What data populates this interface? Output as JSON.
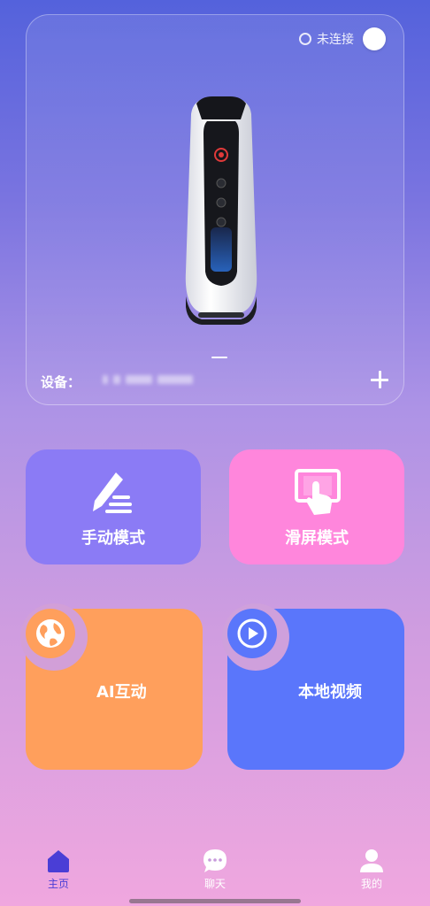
{
  "device_card": {
    "connection_status": "未连接",
    "device_label": "设备：",
    "minus_icon": "minus-icon",
    "plus_icon": "plus-icon"
  },
  "modes": {
    "manual": {
      "label": "手动模式",
      "icon": "pen-edit-icon",
      "color": "#8b7bf5"
    },
    "slide": {
      "label": "滑屏模式",
      "icon": "touch-screen-icon",
      "color": "#ff86dc"
    },
    "ai": {
      "label": "AI互动",
      "icon": "globe-icon",
      "color": "#ff9f5c"
    },
    "video": {
      "label": "本地视频",
      "icon": "play-circle-icon",
      "color": "#5a76fb"
    }
  },
  "bottom_nav": {
    "items": [
      {
        "label": "主页",
        "icon": "home-icon",
        "active": true
      },
      {
        "label": "聊天",
        "icon": "chat-icon",
        "active": false
      },
      {
        "label": "我的",
        "icon": "user-icon",
        "active": false
      }
    ],
    "active_color": "#4a3ed6"
  }
}
